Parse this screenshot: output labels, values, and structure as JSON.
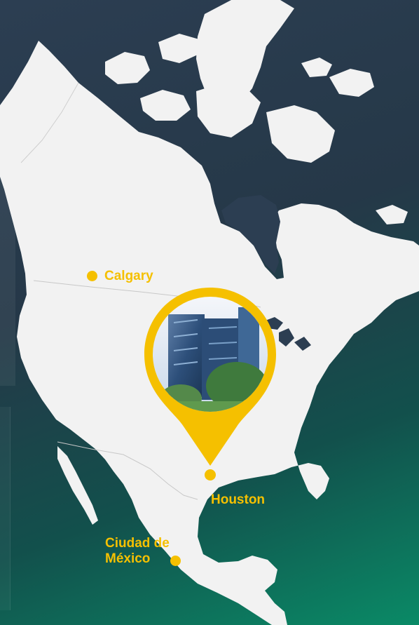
{
  "map": {
    "locations": [
      {
        "id": "calgary",
        "label": "Calgary"
      },
      {
        "id": "houston",
        "label": "Houston",
        "selected": true
      },
      {
        "id": "mexico",
        "label": "Ciudad de México"
      }
    ],
    "pin": {
      "image": "office-tower-photo",
      "color": "#f5c000"
    },
    "colors": {
      "land": "#f2f2f2",
      "accent": "#f5c000",
      "ocean_top": "#2c3e52",
      "ocean_bottom": "#0a8a66"
    }
  },
  "labels": {
    "calgary": "Calgary",
    "houston": "Houston",
    "mexico_line1": "Ciudad de",
    "mexico_line2": "México"
  }
}
